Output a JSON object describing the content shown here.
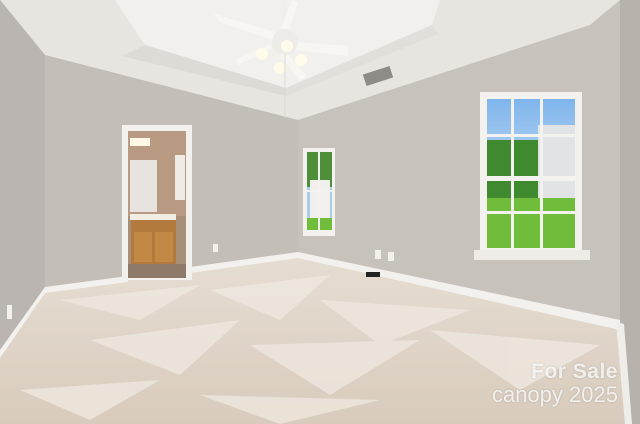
{
  "photo": {
    "subject": "empty bedroom with tray ceiling, ceiling fan, two windows, carpet and open door to bathroom"
  },
  "watermark": {
    "line1": "For Sale",
    "brand": "canopy",
    "year": "2025"
  },
  "colors": {
    "wall_left": "#bdb8b3",
    "wall_back": "#c7c1bb",
    "wall_right": "#c9c3bd",
    "ceiling": "#ebe8e4",
    "carpet": "#e0d5c8",
    "trim": "#f4f2ef",
    "cabinet": "#b27a3c",
    "grass": "#6fbd3a",
    "sky": "#8ec0ee"
  }
}
